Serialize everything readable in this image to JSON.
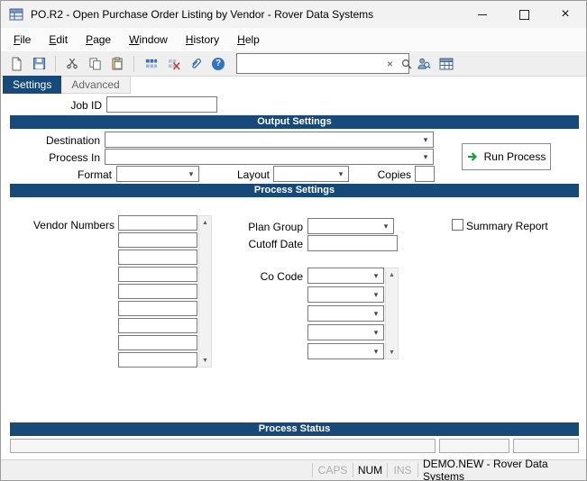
{
  "window": {
    "title": "PO.R2 - Open Purchase Order Listing by Vendor - Rover Data Systems"
  },
  "menu": {
    "items": [
      "File",
      "Edit",
      "Page",
      "Window",
      "History",
      "Help"
    ]
  },
  "toolbar": {
    "icons": [
      "new-document",
      "save",
      "cut",
      "copy",
      "paste",
      "grid-view",
      "grid-delete",
      "attach",
      "help",
      "clear-search",
      "search",
      "user-search",
      "table-view"
    ],
    "search_value": ""
  },
  "tabs": {
    "settings": "Settings",
    "advanced": "Advanced"
  },
  "labels": {
    "job_id": "Job ID",
    "destination": "Destination",
    "process_in": "Process In",
    "format": "Format",
    "layout": "Layout",
    "copies": "Copies",
    "vendor_numbers": "Vendor Numbers",
    "plan_group": "Plan Group",
    "cutoff_date": "Cutoff Date",
    "co_code": "Co Code",
    "summary_report": "Summary Report"
  },
  "sections": {
    "output": "Output Settings",
    "process": "Process Settings",
    "status": "Process Status"
  },
  "buttons": {
    "run_process": "Run Process"
  },
  "inputs": {
    "job_id_value": "",
    "copies_value": "",
    "cutoff_date_value": "",
    "destination_value": "",
    "process_in_value": "",
    "format_value": "",
    "layout_value": "",
    "plan_group_value": ""
  },
  "statusbar": {
    "caps": "CAPS",
    "num": "NUM",
    "ins": "INS",
    "session": "DEMO.NEW - Rover Data Systems"
  },
  "colors": {
    "header": "#17497a",
    "help": "#2e74c9",
    "run_arrow": "#18a038"
  }
}
